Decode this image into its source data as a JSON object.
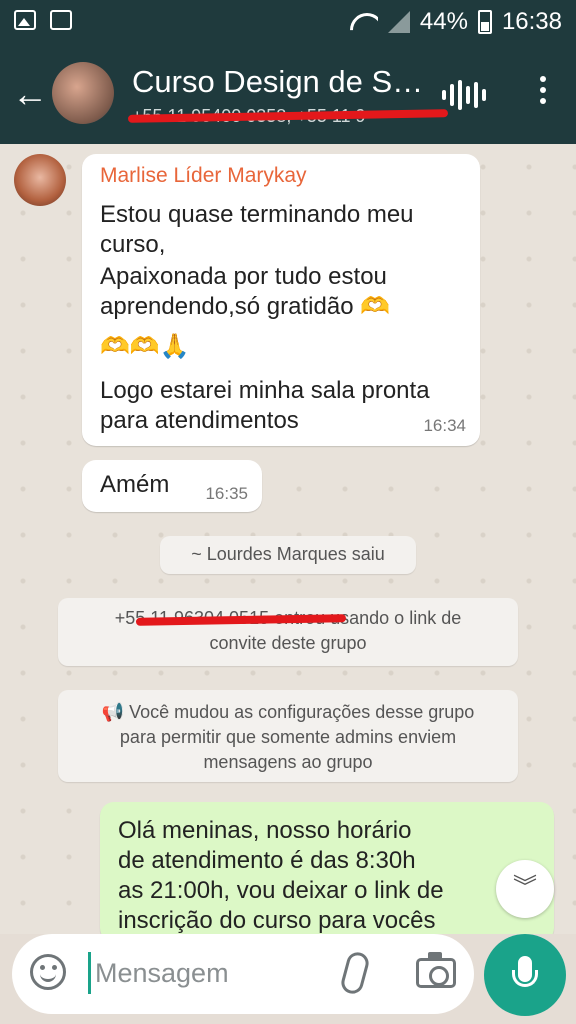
{
  "status_bar": {
    "battery": "44%",
    "time": "16:38"
  },
  "header": {
    "title": "Curso Design de S…",
    "subtitle": "+55 11 95400 0358, +55 11 9"
  },
  "messages": [
    {
      "sender": "Marlise Líder Marykay",
      "lines": [
        "Estou quase terminando meu",
        "curso,",
        "Apaixonada  por tudo estou",
        "aprendendo,só  gratidão 🫶",
        "🫶🫶🙏",
        "Logo estarei minha sala pronta",
        "para atendimentos"
      ],
      "time": "16:34"
    },
    {
      "text": "Amém",
      "time": "16:35"
    }
  ],
  "system_messages": [
    "~ Lourdes Marques saiu",
    [
      "+55 11 96304 0515 entrou usando o link de",
      "convite deste grupo"
    ],
    [
      "📢 Você mudou as configurações desse grupo",
      "para permitir que somente admins enviem",
      "mensagens ao grupo"
    ]
  ],
  "outgoing": {
    "lines": [
      "Olá meninas, nosso horário",
      "de atendimento é das 8:30h",
      "as 21:00h, vou deixar o link de",
      "inscrição do curso para vocês"
    ]
  },
  "composer": {
    "placeholder": "Mensagem"
  },
  "icons": [
    "back-arrow-icon",
    "voice-call-icon",
    "more-options-icon",
    "emoji-icon",
    "attach-icon",
    "camera-icon",
    "mic-icon",
    "scroll-down-icon"
  ],
  "colors": {
    "header": "#1f3a3d",
    "accent": "#1aa38a",
    "sender_name": "#e8663a",
    "outgoing_bubble": "#dcf8c6"
  }
}
